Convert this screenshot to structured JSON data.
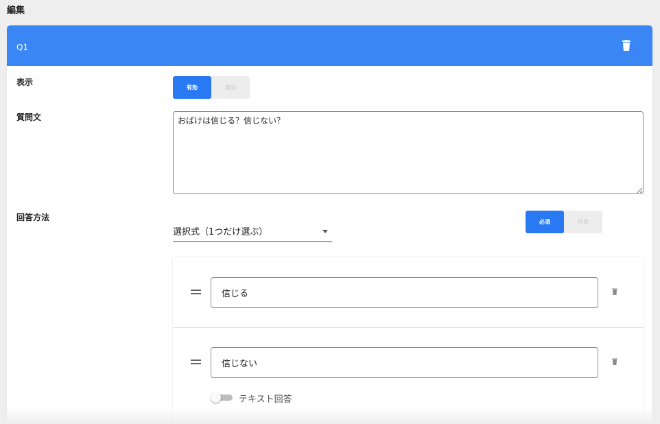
{
  "page": {
    "heading": "編集"
  },
  "question": {
    "label": "Q1",
    "display": {
      "label": "表示",
      "options": [
        "有効",
        "無効"
      ],
      "selected": "有効"
    },
    "text": {
      "label": "質問文",
      "value": "おばけは信じる？信じない？"
    },
    "answer": {
      "label": "回答方法",
      "type_value": "選択式（1つだけ選ぶ）",
      "required_options": [
        "必須",
        "任意"
      ],
      "required_selected": "必須",
      "choices": [
        {
          "value": "信じる"
        },
        {
          "value": "信じない",
          "text_answer_label": "テキスト回答",
          "text_answer_enabled": false
        }
      ]
    }
  },
  "colors": {
    "header": "#3a86f5",
    "accent": "#2979f2"
  },
  "icons": {
    "delete": "trash-icon",
    "drag": "drag-handle-icon",
    "dropdown": "chevron-down-icon"
  }
}
